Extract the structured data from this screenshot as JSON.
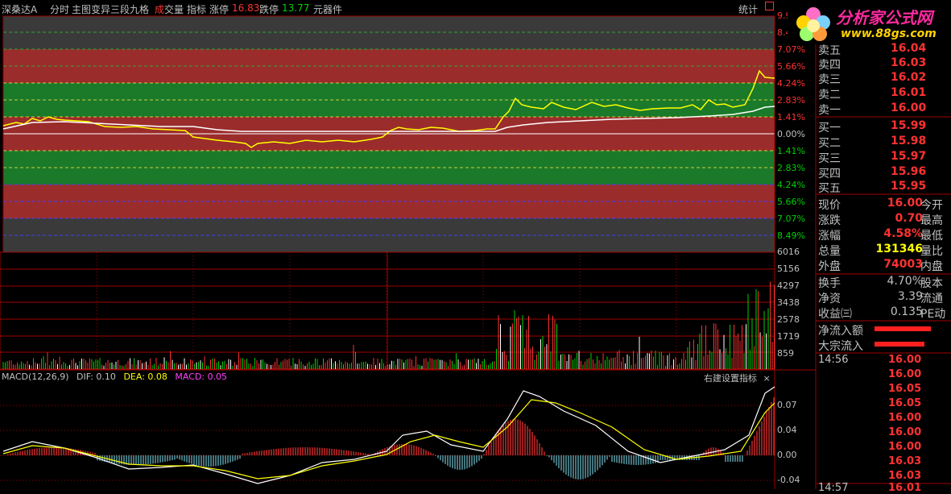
{
  "topbar": {
    "stock_name": "深桑达A",
    "mode": "分时",
    "main_chart": "主图变异三段九格",
    "volume_label_1": "成",
    "volume_label_2": "交量",
    "indicator": "指标",
    "limit_up_label": "涨停",
    "limit_up_value": "16.83",
    "limit_down_label": "跌停",
    "limit_down_value": "13.77",
    "tools": "元器件",
    "stats": "统计"
  },
  "logo": {
    "title": "分析家公式网",
    "url": "www.88gs.com"
  },
  "price_axis": {
    "right_labels": [
      "9.9",
      "8.4",
      "7.07%",
      "5.66%",
      "4.24%",
      "2.83%",
      "1.41%",
      "0.00%",
      "1.41%",
      "2.83%",
      "4.24%",
      "5.66%",
      "7.07%",
      "8.49%"
    ]
  },
  "volume_axis": {
    "labels": [
      "6016",
      "5156",
      "4297",
      "3438",
      "2578",
      "1719",
      "859"
    ]
  },
  "macd": {
    "title": "MACD(12,26,9)",
    "dif_label": "DIF: 0.10",
    "dea_label": "DEA: 0.08",
    "macd_label": "MACD: 0.05",
    "settings": "右建设置指标",
    "close": "×",
    "axis_labels": [
      "0.07",
      "0.04",
      "0.00",
      "-0.04"
    ]
  },
  "orderbook": {
    "asks": [
      {
        "label": "卖五",
        "price": "16.04"
      },
      {
        "label": "卖四",
        "price": "16.03"
      },
      {
        "label": "卖三",
        "price": "16.02"
      },
      {
        "label": "卖二",
        "price": "16.01"
      },
      {
        "label": "卖一",
        "price": "16.00"
      }
    ],
    "bids": [
      {
        "label": "买一",
        "price": "15.99"
      },
      {
        "label": "买二",
        "price": "15.98"
      },
      {
        "label": "买三",
        "price": "15.97"
      },
      {
        "label": "买四",
        "price": "15.96"
      },
      {
        "label": "买五",
        "price": "15.95"
      }
    ]
  },
  "quote": {
    "rows": [
      {
        "k": "现价",
        "v": "16.00",
        "k2": "今开",
        "color": "#ff3232"
      },
      {
        "k": "涨跌",
        "v": "0.70",
        "k2": "最高",
        "color": "#ff3232"
      },
      {
        "k": "涨幅",
        "v": "4.58%",
        "k2": "最低",
        "color": "#ff3232"
      },
      {
        "k": "总量",
        "v": "131346",
        "k2": "量比",
        "color": "#ffff00"
      },
      {
        "k": "外盘",
        "v": "74003",
        "k2": "内盘",
        "color": "#ff3232"
      }
    ],
    "rows2": [
      {
        "k": "换手",
        "v": "4.70%",
        "k2": "股本",
        "color": "#c0c0c0"
      },
      {
        "k": "净资",
        "v": "3.39",
        "k2": "流通",
        "color": "#c0c0c0"
      },
      {
        "k": "收益㈢",
        "v": "0.135",
        "k2": "PE动",
        "color": "#c0c0c0"
      }
    ],
    "flow": [
      {
        "k": "净流入额"
      },
      {
        "k": "大宗流入"
      }
    ]
  },
  "ticks": {
    "time": "14:56",
    "time2": "14:57",
    "prices": [
      "16.00",
      "16.00",
      "16.05",
      "16.05",
      "16.00",
      "16.00",
      "16.00",
      "16.03",
      "16.03"
    ],
    "last_partial": "16.01"
  },
  "colors": {
    "red_band": "#9b2c2c",
    "green_band": "#1a7a2a",
    "gray_band": "#3a3a3a",
    "price_line": "#ffff00",
    "avg_line": "#ffffff",
    "up": "#ff3232",
    "down": "#00d000"
  }
}
